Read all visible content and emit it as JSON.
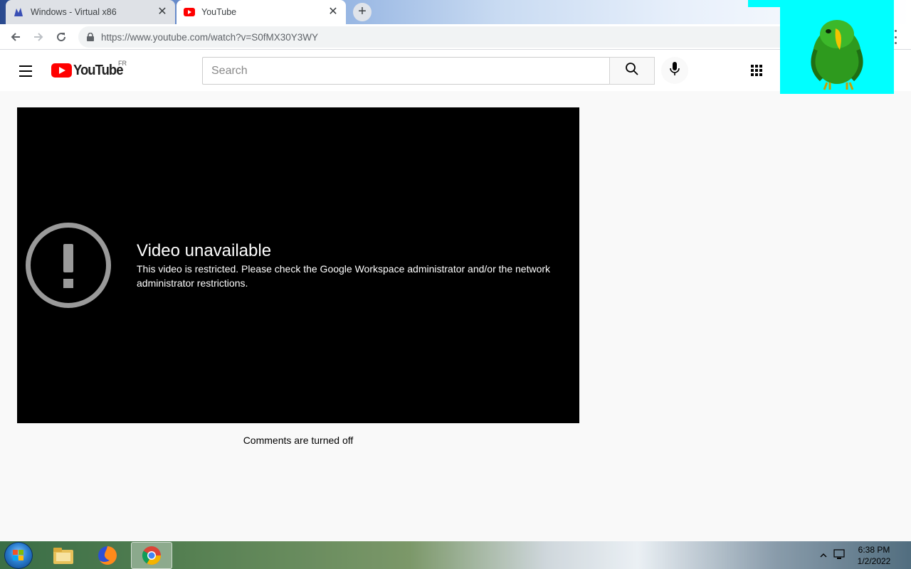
{
  "browser": {
    "tabs": [
      {
        "title": "Windows - Virtual x86",
        "icon": "virtualbox-favicon-icon"
      },
      {
        "title": "YouTube",
        "icon": "youtube-favicon-icon",
        "active": true
      }
    ],
    "url": "https://www.youtube.com/watch?v=S0fMX30Y3WY"
  },
  "youtube": {
    "logo_text": "YouTube",
    "region": "FR",
    "search_placeholder": "Search"
  },
  "player": {
    "error_title": "Video unavailable",
    "error_message": "This video is restricted. Please check the Google Workspace administrator and/or the network administrator restrictions."
  },
  "comments_status": "Comments are turned off",
  "taskbar": {
    "time": "6:38 PM",
    "date": "1/2/2022"
  },
  "colors": {
    "youtube_red": "#ff0000",
    "player_bg": "#000000",
    "overlay_cyan": "#00ffff"
  }
}
